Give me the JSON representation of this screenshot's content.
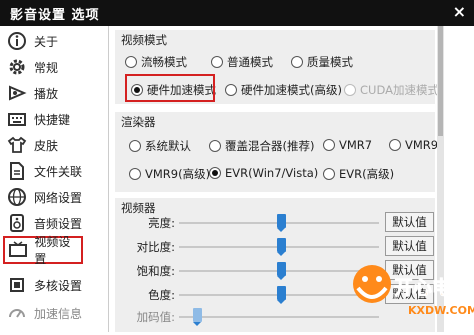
{
  "window": {
    "title": "影音设置 选项",
    "close": "×"
  },
  "sidebar": {
    "items": [
      {
        "label": "关于",
        "icon": "info-icon"
      },
      {
        "label": "常规",
        "icon": "gear-icon"
      },
      {
        "label": "播放",
        "icon": "play-icon"
      },
      {
        "label": "快捷键",
        "icon": "keyboard-icon"
      },
      {
        "label": "皮肤",
        "icon": "shirt-icon"
      },
      {
        "label": "文件关联",
        "icon": "file-icon"
      },
      {
        "label": "网络设置",
        "icon": "globe-icon"
      },
      {
        "label": "音频设置",
        "icon": "speaker-icon"
      },
      {
        "label": "视频设置",
        "icon": "tv-icon"
      },
      {
        "label": "多核设置",
        "icon": "cpu-icon"
      },
      {
        "label": "加速信息",
        "icon": "speed-icon"
      }
    ],
    "selected": "视频设置"
  },
  "video_mode": {
    "title": "视频模式",
    "options": [
      "流畅模式",
      "普通模式",
      "质量模式",
      "硬件加速模式",
      "硬件加速模式(高级)",
      "CUDA加速模式"
    ],
    "selected": "硬件加速模式",
    "disabled": [
      "CUDA加速模式"
    ]
  },
  "renderer": {
    "title": "渲染器",
    "options": [
      "系统默认",
      "覆盖混合器(推荐)",
      "VMR7",
      "VMR9",
      "VMR9(高级)",
      "EVR(Win7/Vista)",
      "EVR(高级)"
    ],
    "selected": "EVR(Win7/Vista)"
  },
  "video": {
    "title": "视频器",
    "sliders": [
      {
        "label": "亮度:",
        "level": 0.5,
        "reset": "默认值"
      },
      {
        "label": "对比度:",
        "level": 0.5,
        "reset": "默认值"
      },
      {
        "label": "饱和度:",
        "level": 0.5,
        "reset": "默认值"
      },
      {
        "label": "色度:",
        "level": 0.5,
        "reset": "默认值"
      }
    ],
    "accel_label": "加码值:"
  },
  "watermark": {
    "text": "开心电玩",
    "site": "KXDW.COM"
  }
}
